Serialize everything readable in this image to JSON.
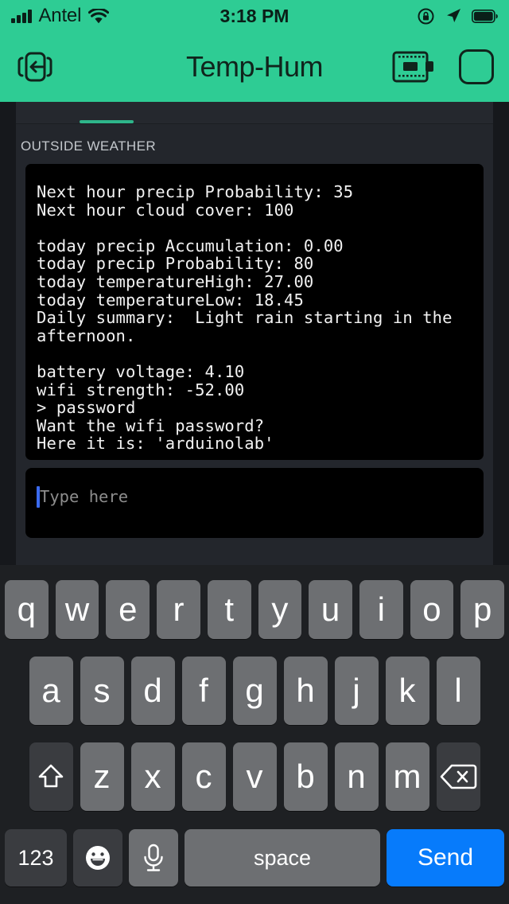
{
  "statusbar": {
    "carrier": "Antel",
    "time": "3:18 PM",
    "signal_icon": "cellular-bars-icon",
    "wifi_icon": "wifi-icon",
    "rotation_lock_icon": "rotation-lock-icon",
    "location_icon": "location-arrow-icon",
    "battery_icon": "battery-full-icon",
    "bg_color": "#2ecc94"
  },
  "navbar": {
    "title": "Temp-Hum",
    "back_icon": "exit-left-icon",
    "board_icon": "microcontroller-board-icon",
    "square_icon": "rounded-square-icon",
    "bg_color": "#2ecc94"
  },
  "main": {
    "tab_indicator_color": "#2eb58a",
    "section_label": "OUTSIDE WEATHER",
    "terminal_text": "Next hour precip Probability: 35\nNext hour cloud cover: 100\n\ntoday precip Accumulation: 0.00\ntoday precip Probability: 80\ntoday temperatureHigh: 27.00\ntoday temperatureLow: 18.45\nDaily summary:  Light rain starting in the afternoon.\n\nbattery voltage: 4.10\nwifi strength: -52.00\n> password\nWant the wifi password?\nHere it is: 'arduinolab'",
    "input": {
      "value": "",
      "placeholder": "Type here",
      "caret_color": "#3b6bf0"
    }
  },
  "keyboard": {
    "theme": "dark",
    "row1": [
      "q",
      "w",
      "e",
      "r",
      "t",
      "y",
      "u",
      "i",
      "o",
      "p"
    ],
    "row2": [
      "a",
      "s",
      "d",
      "f",
      "g",
      "h",
      "j",
      "k",
      "l"
    ],
    "row3": [
      "z",
      "x",
      "c",
      "v",
      "b",
      "n",
      "m"
    ],
    "shift_icon": "shift-arrow-icon",
    "backspace_icon": "backspace-delete-icon",
    "numbers_label": "123",
    "emoji_icon": "emoji-smiley-icon",
    "dictation_icon": "microphone-icon",
    "space_label": "space",
    "send_label": "Send",
    "send_color": "#077bfb",
    "key_color": "#6d6f72",
    "dark_key_color": "#3a3c40"
  }
}
